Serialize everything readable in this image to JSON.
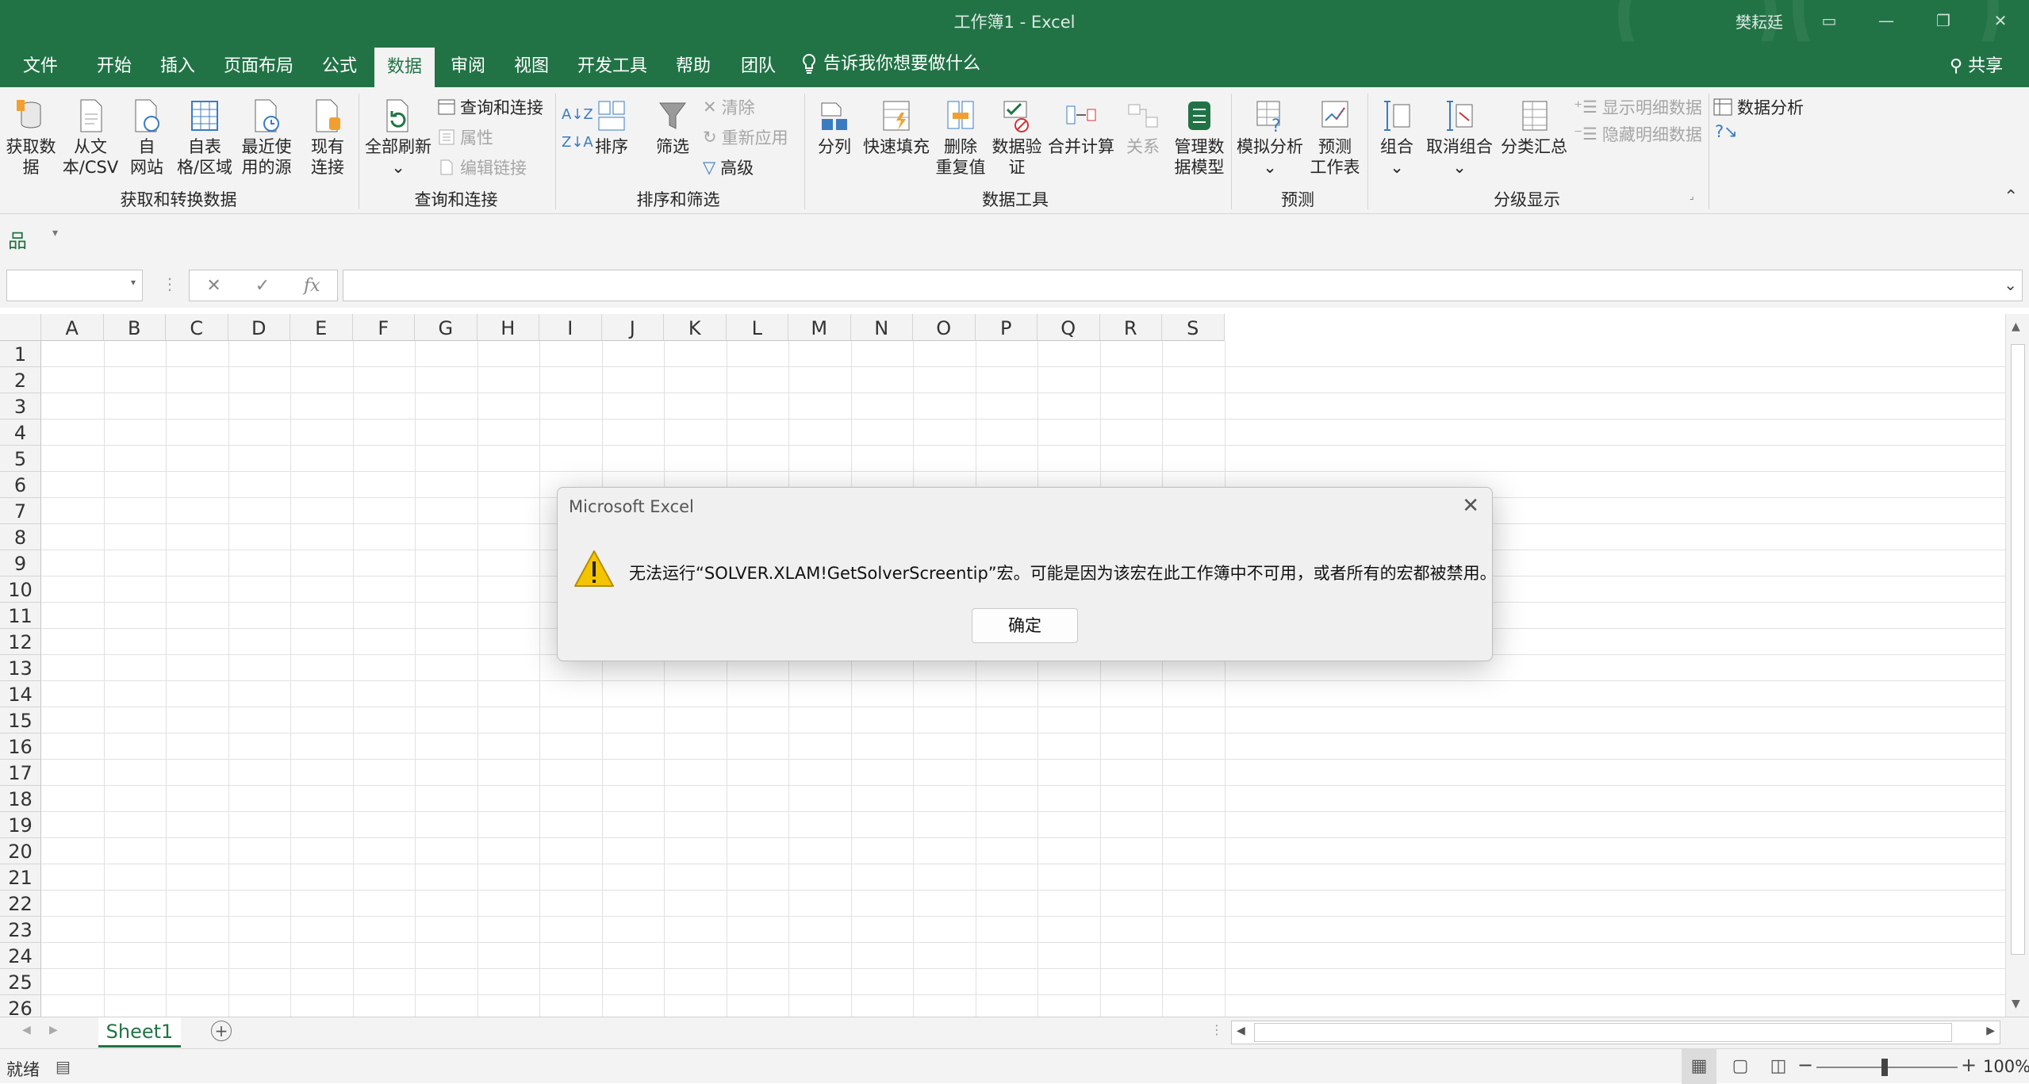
{
  "window": {
    "title": "工作簿1  -  Excel",
    "user": "樊耘廷"
  },
  "tabs": [
    {
      "label": "文件",
      "left": 0,
      "width": 100
    },
    {
      "label": "开始"
    },
    {
      "label": "插入"
    },
    {
      "label": "页面布局"
    },
    {
      "label": "公式"
    },
    {
      "label": "数据"
    },
    {
      "label": "审阅"
    },
    {
      "label": "视图"
    },
    {
      "label": "开发工具"
    },
    {
      "label": "帮助"
    },
    {
      "label": "团队"
    }
  ],
  "tellme": "告诉我你想要做什么",
  "share": "共享",
  "ribbon": {
    "get_data": "获取数\n据",
    "from_csv": "从文\n本/CSV",
    "from_web": "自\n网站",
    "from_table": "自表\n格/区域",
    "recent_sources": "最近使\n用的源",
    "existing_conn": "现有\n连接",
    "refresh_all": "全部刷新",
    "queries_conn": "查询和连接",
    "properties": "属性",
    "edit_links": "编辑链接",
    "sort": "排序",
    "filter": "筛选",
    "clear": "清除",
    "reapply": "重新应用",
    "advanced": "高级",
    "text_to_cols": "分列",
    "flash_fill": "快速填充",
    "remove_dup": "删除\n重复值",
    "data_valid": "数据验\n证",
    "consolidate": "合并计算",
    "relations": "关系",
    "data_model": "管理数\n据模型",
    "what_if": "模拟分析",
    "forecast": "预测\n工作表",
    "group": "组合",
    "ungroup": "取消组合",
    "subtotal": "分类汇总",
    "show_detail": "显示明细数据",
    "hide_detail": "隐藏明细数据",
    "data_analysis": "数据分析",
    "groups": [
      "获取和转换数据",
      "查询和连接",
      "排序和筛选",
      "数据工具",
      "预测",
      "分级显示"
    ]
  },
  "columns": [
    "A",
    "B",
    "C",
    "D",
    "E",
    "F",
    "G",
    "H",
    "I",
    "J",
    "K",
    "L",
    "M",
    "N",
    "O",
    "P",
    "Q",
    "R",
    "S"
  ],
  "rows": [
    "1",
    "2",
    "3",
    "4",
    "5",
    "6",
    "7",
    "8",
    "9",
    "10",
    "11",
    "12",
    "13",
    "14",
    "15",
    "16",
    "17",
    "18",
    "19",
    "20",
    "21",
    "22",
    "23",
    "24",
    "25",
    "26"
  ],
  "sheet": {
    "name": "Sheet1"
  },
  "status": {
    "ready": "就绪",
    "zoom": "100%"
  },
  "dialog": {
    "title": "Microsoft Excel",
    "message": "无法运行“SOLVER.XLAM!GetSolverScreentip”宏。可能是因为该宏在此工作簿中不可用，或者所有的宏都被禁用。",
    "ok": "确定"
  },
  "colors": {
    "brand": "#217346",
    "warning": "#f5c400"
  }
}
